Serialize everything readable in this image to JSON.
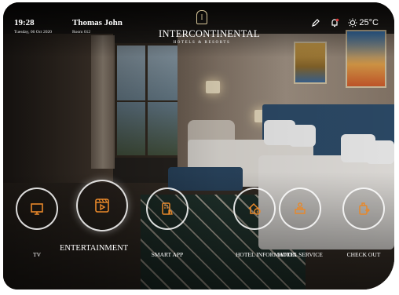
{
  "header": {
    "time": "19:28",
    "date": "Tuesday, 06 Oct 2020",
    "guest_name": "Thomas John",
    "room": "Room 012",
    "brand_name": "INTERCONTINENTAL",
    "brand_sub": "HOTELS & RESORTS",
    "brand_mark": "I",
    "temperature": "25°C"
  },
  "menu": [
    {
      "label": "TV",
      "icon": "tv-icon"
    },
    {
      "label": "ENTERTAINMENT",
      "icon": "entertainment-icon"
    },
    {
      "label": "SMART APP",
      "icon": "smart-app-icon"
    },
    {
      "label": "HOTEL INFORMATION",
      "icon": "hotel-information-icon"
    },
    {
      "label": "HOTEL SERVICE",
      "icon": "hotel-service-icon"
    },
    {
      "label": "CHECK OUT",
      "icon": "check-out-icon"
    }
  ],
  "colors": {
    "icon_accent": "#e8882a",
    "ring": "#ffffff",
    "headboard": "#2f4f6e"
  }
}
